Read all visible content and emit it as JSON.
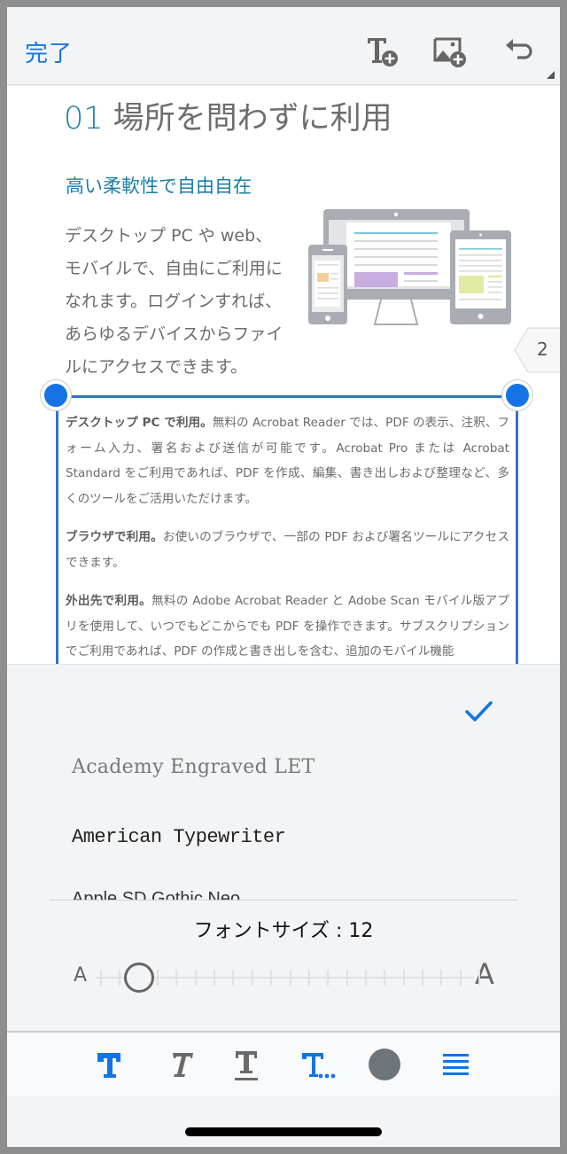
{
  "topbar": {
    "done_label": "完了",
    "icons": [
      "add-text-icon",
      "add-image-icon",
      "undo-icon"
    ]
  },
  "document": {
    "heading_number": "01",
    "heading_text": " 場所を問わずに利用",
    "subheading": "高い柔軟性で自由自在",
    "intro": "デスクトップ PC や web、モバイルで、自由にご利用になれます。ログインすれば、あらゆるデバイスからファイルにアクセスできます。",
    "page_number": "2",
    "selected_text_box": {
      "paragraphs": [
        {
          "lead": "デスクトップ PC で利用。",
          "body": "無料の Acrobat Reader では、PDF の表示、注釈、フォーム入力、署名および送信が可能です。Acrobat Pro または Acrobat Standard をご利用であれば、PDF を作成、編集、書き出しおよび整理など、多くのツールをご活用いただけます。"
        },
        {
          "lead": "ブラウザで利用。",
          "body": "お使いのブラウザで、一部の PDF および署名ツールにアクセスできます。"
        },
        {
          "lead": "外出先で利用。",
          "body": "無料の Adobe Acrobat Reader と Adobe Scan モバイル版アプリを使用して、いつでもどこからでも PDF を操作できます。サブスクリプションでご利用であれば、PDF の作成と書き出しを含む、追加のモバイル機能"
        }
      ]
    }
  },
  "font_panel": {
    "fonts": [
      {
        "name": "Academy Engraved LET"
      },
      {
        "name": "American Typewriter"
      },
      {
        "name": "Apple SD Gothic Neo"
      }
    ],
    "selected_indicator": "check-icon",
    "font_size_label": "フォントサイズ",
    "font_size_separator": " : ",
    "font_size_value": "12",
    "font_size_display": "フォントサイズ : 12",
    "slider": {
      "min_label": "A",
      "max_label": "A",
      "steps": 21,
      "current_step": 2
    }
  },
  "toolbar": {
    "tools": [
      {
        "name": "bold",
        "active": true
      },
      {
        "name": "italic",
        "active": false
      },
      {
        "name": "underline",
        "active": false
      },
      {
        "name": "more-text-options",
        "active": true
      },
      {
        "name": "text-color",
        "color": "#6d747a"
      },
      {
        "name": "alignment",
        "active": true
      }
    ]
  },
  "colors": {
    "accent": "#1473e6",
    "heading_teal": "#1a7fa8",
    "selection_border": "#2f75c7",
    "icon_gray": "#666666",
    "text_color_swatch": "#6d747a"
  }
}
